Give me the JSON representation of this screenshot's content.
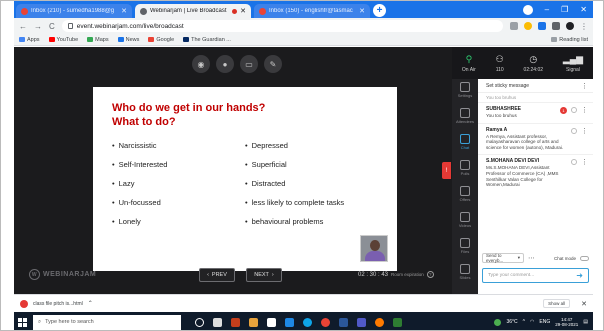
{
  "browser": {
    "tabs": [
      {
        "label": "Inbox (210) - sumedha1988@g",
        "active": false
      },
      {
        "label": "Webinarjam | Live Broadcast",
        "active": true
      },
      {
        "label": "Inbox (150) - englishfr@tasmac",
        "active": false
      }
    ],
    "url": "event.webinarjam.com/live/broadcast",
    "bookmarks": [
      "Apps",
      "YouTube",
      "Maps",
      "News",
      "Google",
      "The Guardian ..."
    ],
    "reading_list": "Reading list"
  },
  "stage": {
    "slide": {
      "title_line1": "Who do we get in our hands?",
      "title_line2": "What to do?",
      "left_bullets": [
        "Narcissistic",
        "Self-Interested",
        "Lazy",
        "Un-focussed",
        "Lonely"
      ],
      "right_bullets": [
        "Depressed",
        "Superficial",
        "Distracted",
        "less likely to complete tasks",
        "behavioural problems"
      ]
    },
    "logo_text": "WEBINARJAM",
    "prev_label": "PREV",
    "next_label": "NEXT",
    "timer": "02 : 30 : 43",
    "timer_caption": "Room expiration"
  },
  "panel": {
    "stats": [
      {
        "icon": "signal-icon",
        "label": "On Air"
      },
      {
        "icon": "attendees-icon",
        "label": "110"
      },
      {
        "icon": "clock-icon",
        "label": "02:24:02"
      },
      {
        "icon": "bars-icon",
        "label": "Signal"
      }
    ],
    "sidebar": [
      "Settings",
      "Attendees",
      "Chat",
      "Polls",
      "Offers",
      "Videos",
      "Files",
      "Slides"
    ],
    "sticky_label": "Set sticky message",
    "faded_message": "You too bruhus",
    "messages": [
      {
        "name": "SUBHASHREE",
        "text": "You too bruhus",
        "badge": "1"
      },
      {
        "name": "Ramya A",
        "text": "A Remya, Assistant professor, malayasharavan college of arts and science for women (autono), Madurai."
      },
      {
        "name": "S.MOHANA DEVI DEVI",
        "text": "Ms.S.MOHANA DEVI,Assistant Professor of Commerce (CA) ,MMS Senthilkar Valan College for Women,Madurai"
      }
    ],
    "send_to_label": "Send to everyb...",
    "chat_mode_label": "Chat mode",
    "input_placeholder": "Type your comment..."
  },
  "download": {
    "file": "class file pitch is...html",
    "show_all": "Show all"
  },
  "taskbar": {
    "search_placeholder": "Type here to search",
    "weather": "36°C",
    "lang": "ENG",
    "time": "14:47",
    "date": "29-08-2021"
  },
  "colors": {
    "accent": "#1a73e8",
    "slide_title": "#c00000",
    "chat_active": "#3aa0d8",
    "alert": "#e53935"
  }
}
